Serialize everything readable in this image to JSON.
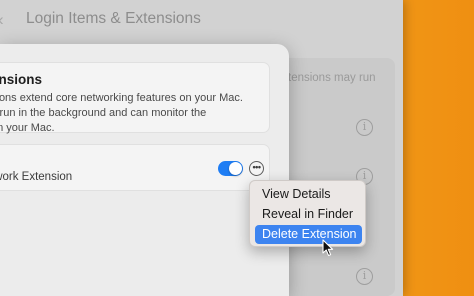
{
  "window": {
    "title": "Login Items & Extensions",
    "back_icon": "chevron-left-icon"
  },
  "background_panel": {
    "snippet": "tensions may run",
    "info_icon_glyph": "i"
  },
  "sheet": {
    "info_card": {
      "title": "ensions",
      "description_lines": [
        "sions extend core networking features on your Mac.",
        "s run in the background and can monitor the",
        "on your Mac."
      ]
    },
    "extension_item": {
      "label": "twork Extension",
      "toggle_on": true,
      "toggle_color": "#1e7df4",
      "more_glyph": "•••"
    }
  },
  "context_menu": {
    "items": [
      {
        "label": "View Details",
        "highlighted": false
      },
      {
        "label": "Reveal in Finder",
        "highlighted": false
      },
      {
        "label": "Delete Extension",
        "highlighted": true
      }
    ],
    "highlight_color": "#3d84f0"
  }
}
